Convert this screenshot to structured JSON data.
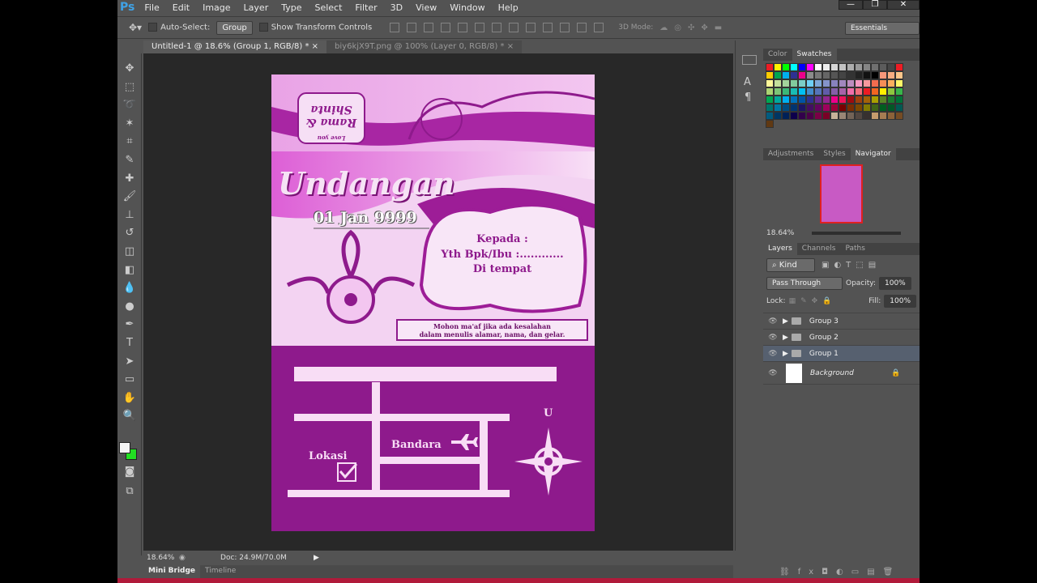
{
  "app": {
    "logo": "Ps",
    "menu": [
      "File",
      "Edit",
      "Image",
      "Layer",
      "Type",
      "Select",
      "Filter",
      "3D",
      "View",
      "Window",
      "Help"
    ],
    "window_controls": [
      "—",
      "❐",
      "✕"
    ]
  },
  "options": {
    "auto_select_label": "Auto-Select:",
    "auto_select_value": "Group",
    "show_transform_label": "Show Transform Controls",
    "mode_3d_label": "3D Mode:",
    "workspace": "Essentials"
  },
  "tabs": [
    {
      "label": "Untitled-1 @ 18.6% (Group 1, RGB/8) *",
      "close": "×"
    },
    {
      "label": "biy6kjX9T.png @ 100% (Layer 0, RGB/8) *",
      "close": "×"
    }
  ],
  "tools": [
    "move",
    "marquee",
    "lasso",
    "magic-wand",
    "crop",
    "eyedropper",
    "healing",
    "brush",
    "stamp",
    "history-brush",
    "eraser",
    "gradient",
    "blur",
    "dodge",
    "pen",
    "type",
    "path-select",
    "shape",
    "hand",
    "zoom"
  ],
  "tool_glyphs": [
    "✥",
    "⬚",
    "➰",
    "✶",
    "⌗",
    "✎",
    "✚",
    "🖌",
    "⊥",
    "↺",
    "◫",
    "◧",
    "💧",
    "●",
    "✒",
    "T",
    "➤",
    "▭",
    "✋",
    "🔍"
  ],
  "colors": {
    "foreground": "#f4f4f4",
    "background": "#22e022"
  },
  "document": {
    "couple": "Rama & Shinta",
    "love": "Love you",
    "title": "Undangan",
    "date": "01 Jan 9999",
    "kepada": "Kepada :",
    "yth": "Yth Bpk/Ibu :............",
    "tempat": "Di tempat",
    "mohon1": "Mohon ma'af jika ada kesalahan",
    "mohon2": "dalam menulis alamar, nama, dan gelar.",
    "lokasi": "Lokasi",
    "bandara": "Bandara",
    "north": "U"
  },
  "status": {
    "zoom": "18.64%",
    "doc": "Doc: 24.9M/70.0M"
  },
  "bottom_tabs": [
    "Mini Bridge",
    "Timeline"
  ],
  "panels": {
    "color_tabs": [
      "Color",
      "Swatches"
    ],
    "swatches": [
      "#ed1c24",
      "#fff200",
      "#00ff00",
      "#00ffff",
      "#0000ff",
      "#ff00ff",
      "#ffffff",
      "#ebebeb",
      "#d6d6d6",
      "#c2c2c2",
      "#adadad",
      "#999999",
      "#858585",
      "#707070",
      "#5c5c5c",
      "#474747",
      "#ed1c24",
      "#ffcc00",
      "#00a651",
      "#00aeef",
      "#2e3192",
      "#ec008c",
      "#8c8c8c",
      "#777777",
      "#666666",
      "#555555",
      "#444444",
      "#333333",
      "#222222",
      "#111111",
      "#000000",
      "#f7977a",
      "#f9ad81",
      "#fdc68a",
      "#fff79a",
      "#c4df9b",
      "#a3d39c",
      "#82ca9d",
      "#7bcdc8",
      "#6ecff6",
      "#7ea7d8",
      "#8493ca",
      "#8882be",
      "#a187be",
      "#bc8dbf",
      "#f49ac2",
      "#f6989d",
      "#f26c4f",
      "#f68e56",
      "#fbaf5d",
      "#fff568",
      "#acd373",
      "#7cc576",
      "#3bb878",
      "#1abbb4",
      "#00bff3",
      "#438ccb",
      "#5574b9",
      "#605ca8",
      "#855fa8",
      "#a763a8",
      "#f06eaa",
      "#f26d7d",
      "#ed1c24",
      "#f26522",
      "#ffef00",
      "#8dc63f",
      "#39b54a",
      "#00a651",
      "#00a99d",
      "#00aeef",
      "#0072bc",
      "#0054a6",
      "#2e3192",
      "#662d91",
      "#92278f",
      "#ec008c",
      "#ed145b",
      "#9e0b0f",
      "#a0410d",
      "#a36209",
      "#aba000",
      "#598527",
      "#197b30",
      "#007236",
      "#00746b",
      "#0076a3",
      "#004b80",
      "#003471",
      "#1b1464",
      "#440e62",
      "#630460",
      "#9e005d",
      "#9e0039",
      "#790000",
      "#7b2e00",
      "#7d4900",
      "#827b00",
      "#406618",
      "#005e20",
      "#005826",
      "#005952",
      "#005b7f",
      "#003663",
      "#002157",
      "#0d004c",
      "#32004b",
      "#4b0049",
      "#7b0046",
      "#7a0026",
      "#c7b299",
      "#998675",
      "#736357",
      "#534741",
      "#37302f",
      "#c69c6d",
      "#a67c52",
      "#8c6239",
      "#754c24",
      "#603913"
    ],
    "adjust_tabs": [
      "Adjustments",
      "Styles",
      "Navigator"
    ],
    "nav_zoom": "18.64%",
    "layer_tabs": [
      "Layers",
      "Channels",
      "Paths"
    ],
    "kind": "Kind",
    "blend": "Pass Through",
    "opacity_label": "Opacity:",
    "opacity": "100%",
    "lock_label": "Lock:",
    "fill_label": "Fill:",
    "fill": "100%",
    "layers": [
      {
        "name": "Group 3",
        "type": "group"
      },
      {
        "name": "Group 2",
        "type": "group"
      },
      {
        "name": "Group 1",
        "type": "group",
        "selected": true
      },
      {
        "name": "Background",
        "type": "background"
      }
    ]
  }
}
